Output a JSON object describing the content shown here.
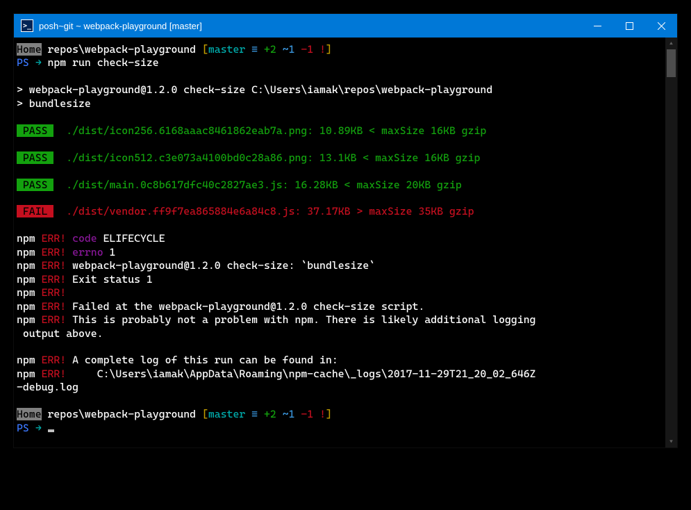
{
  "titlebar": {
    "text": "posh~git ~ webpack-playground [master]"
  },
  "prompt1": {
    "home": "Home",
    "path": " repos\\webpack-playground ",
    "br_open": "[",
    "branch": "master",
    "equiv": " ≡ ",
    "plus": "+2",
    "tilde": " ~1 ",
    "minus": "-1 ",
    "bang": "!",
    "br_close": "]"
  },
  "ps1": {
    "ps": "PS ",
    "arrow": "→",
    "cmd": " npm run check-size"
  },
  "run1": "> webpack-playground@1.2.0 check-size C:\\Users\\iamak\\repos\\webpack-playground",
  "run2": "> bundlesize",
  "pass": " PASS ",
  "fail": " FAIL ",
  "r1": "  ./dist/icon256.6168aaac8461862eab7a.png: 10.89KB < maxSize 16KB gzip",
  "r2": "  ./dist/icon512.c3e073a4100bd0c28a86.png: 13.1KB < maxSize 16KB gzip",
  "r3": "  ./dist/main.0c8b617dfc40c2827ae3.js: 16.28KB < maxSize 20KB gzip",
  "r4": "  ./dist/vendor.ff9f7ea865884e6a84c8.js: 37.17KB > maxSize 35KB gzip",
  "npm": "npm",
  "err": " ERR!",
  "e1a": " code",
  "e1b": " ELIFECYCLE",
  "e2a": " errno",
  "e2b": " 1",
  "e3": " webpack-playground@1.2.0 check-size: `bundlesize`",
  "e4": " Exit status 1",
  "e5": " Failed at the webpack-playground@1.2.0 check-size script.",
  "e6": " This is probably not a problem with npm. There is likely additional logging",
  "e6b": " output above.",
  "e7": " A complete log of this run can be found in:",
  "e8": "     C:\\Users\\iamak\\AppData\\Roaming\\npm-cache\\_logs\\2017-11-29T21_20_02_646Z",
  "e8b": "-debug.log",
  "ps2": {
    "ps": "PS ",
    "arrow": "→",
    "cmd": " "
  }
}
